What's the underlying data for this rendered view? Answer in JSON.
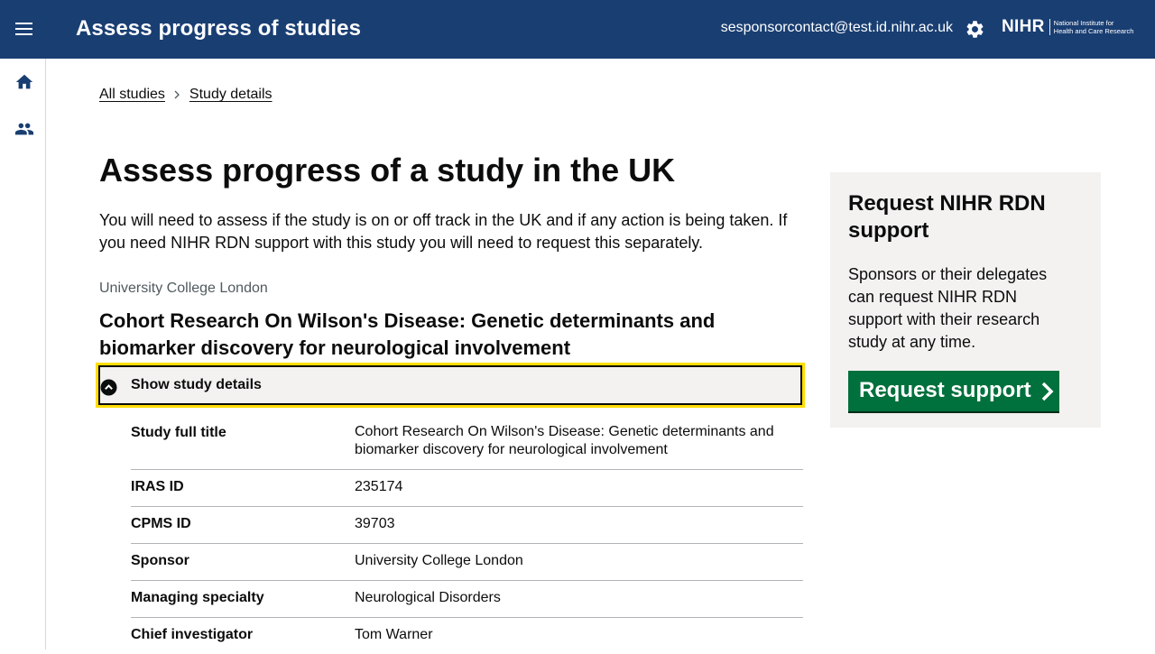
{
  "header": {
    "title": "Assess progress of studies",
    "user_email": "sesponsorcontact@test.id.nihr.ac.uk",
    "logo_main": "NIHR",
    "logo_sub_line1": "National Institute for",
    "logo_sub_line2": "Health and Care Research"
  },
  "icons": {
    "menu": "hamburger-menu-icon",
    "settings": "gear-icon",
    "home": "home-icon",
    "users": "people-icon",
    "breadcrumb_separator": "chevron-right-icon",
    "toggle": "chevron-up-circle-icon",
    "button_arrow": "chevron-right-icon"
  },
  "breadcrumb": {
    "items": [
      {
        "label": "All studies"
      },
      {
        "label": "Study details"
      }
    ]
  },
  "main": {
    "heading": "Assess progress of a study in the UK",
    "intro": "You will need to assess if the study is on or off track in the UK and if any action is being taken. If you need NIHR RDN support with this study you will need to request this separately.",
    "organisation": "University College London",
    "study_title": "Cohort Research On Wilson's Disease: Genetic determinants and biomarker discovery for neurological involvement",
    "details_toggle_label": "Show study details",
    "details": [
      {
        "key": "Study full title",
        "value": "Cohort Research On Wilson's Disease: Genetic determinants and biomarker discovery for neurological involvement"
      },
      {
        "key": "IRAS ID",
        "value": "235174"
      },
      {
        "key": "CPMS ID",
        "value": "39703"
      },
      {
        "key": "Sponsor",
        "value": "University College London"
      },
      {
        "key": "Managing specialty",
        "value": "Neurological Disorders"
      },
      {
        "key": "Chief investigator",
        "value": "Tom Warner"
      }
    ]
  },
  "aside": {
    "heading": "Request NIHR RDN support",
    "body": "Sponsors or their delegates can request NIHR RDN support with their research study at any time.",
    "button_label": "Request support"
  },
  "colors": {
    "header_bg": "#193e72",
    "button_green": "#00703c",
    "focus_yellow": "#ffdd00",
    "panel_grey": "#f3f2f1"
  }
}
